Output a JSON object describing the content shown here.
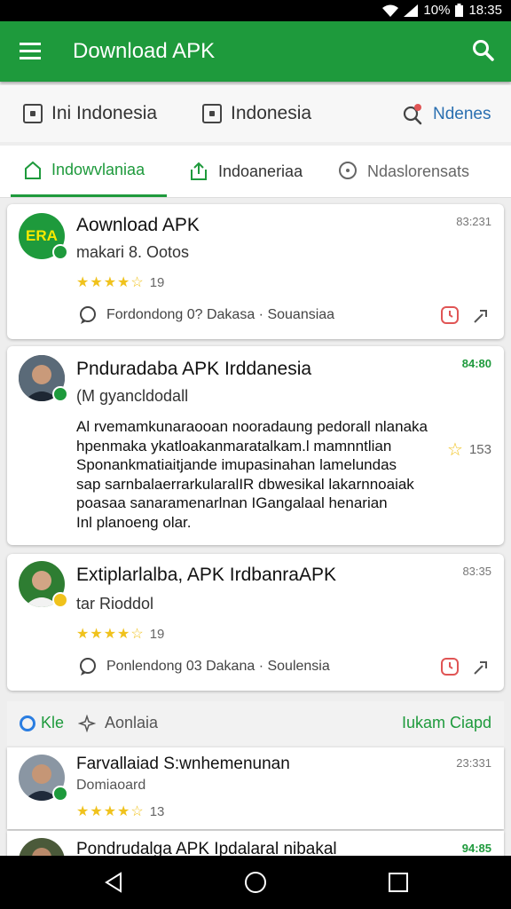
{
  "status": {
    "battery": "10%",
    "time": "18:35"
  },
  "appbar": {
    "title": "Download APK"
  },
  "filters": [
    {
      "label": "Ini Indonesia"
    },
    {
      "label": "Indonesia"
    },
    {
      "label": "Ndenes"
    }
  ],
  "tabs": [
    {
      "label": "Indowvlaniaa"
    },
    {
      "label": "Indoaneriaa"
    },
    {
      "label": "Ndaslorensats"
    }
  ],
  "posts": [
    {
      "name": "Aownload APK",
      "sub": "makari 8. Ootos",
      "time": "83:231",
      "rating": "19",
      "meta": "Fordondong 0? Dakasa · Souansiaa",
      "avatar_text": "ERA"
    },
    {
      "name": "Pnduradaba APK Irddanesia",
      "sub": "(M gyancldodall",
      "time": "84:80",
      "rating": "153",
      "body": [
        "Al rvemamkunaraooan nooradaung pedorall nlanaka",
        "hpenmaka ykatloakanmaratalkam.l mamnntlian",
        "Sponankmatiaitjande imupasinahan lamelundas",
        "sap sarnbalaerrarkularalIR dbwesikal lakarnnoaiak",
        "poasaa sanaramenarlnan IGangalaal henarian",
        "Inl planoeng olar."
      ]
    },
    {
      "name": "Extiplarlalba, APK IrdbanraAPK",
      "sub": "tar Rioddol",
      "time": "83:35",
      "rating": "19",
      "meta": "Ponlendong 03 Dakana · Soulensia"
    }
  ],
  "section": {
    "left": "Kle",
    "middle": "Aonlaia",
    "right": "Iukam Ciapd"
  },
  "posts2": [
    {
      "name": "Farvallaiad S:wnhemenunan",
      "sub": "Domiaoard",
      "time": "23:331",
      "rating": "13"
    },
    {
      "name": "Pondrudalga APK Ipdalaral nibakal",
      "time": "94:85"
    }
  ],
  "colors": {
    "primary": "#1e9a3c",
    "star": "#f0c21c",
    "alert": "#e05555"
  }
}
